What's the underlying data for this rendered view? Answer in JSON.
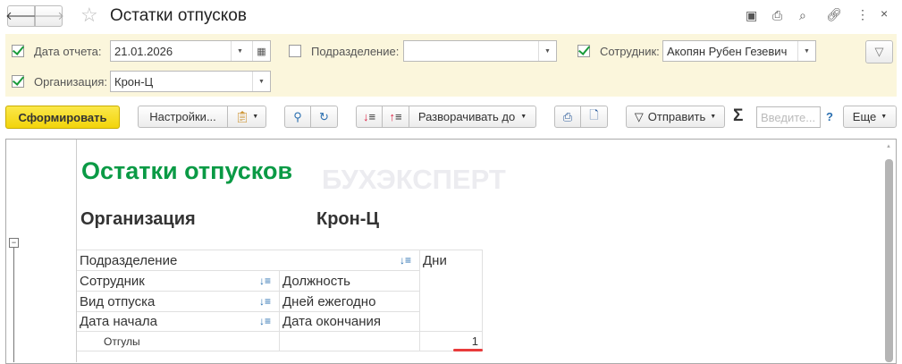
{
  "window": {
    "title": "Остатки отпусков",
    "close": "×"
  },
  "filters": {
    "report_date": {
      "label": "Дата отчета:",
      "value": "21.01.2026",
      "checked": true
    },
    "department": {
      "label": "Подразделение:",
      "value": "",
      "checked": false
    },
    "employee": {
      "label": "Сотрудник:",
      "value": "Акопян Рубен Гезевич",
      "checked": true
    },
    "organization": {
      "label": "Организация:",
      "value": "Крон-Ц",
      "checked": true
    }
  },
  "toolbar": {
    "generate": "Сформировать",
    "settings": "Настройки...",
    "expand_to": "Разворачивать до",
    "send": "Отправить",
    "sigma": "Σ",
    "search_placeholder": "Введите...",
    "help": "?",
    "more": "Еще"
  },
  "report": {
    "title": "Остатки отпусков",
    "watermark": "БУХЭКСПЕРТ",
    "org_label": "Организация",
    "org_value": "Крон-Ц",
    "headers": {
      "department": "Подразделение",
      "days": "Дни",
      "employee": "Сотрудник",
      "position": "Должность",
      "leave_type": "Вид отпуска",
      "days_yearly": "Дней ежегодно",
      "start_date": "Дата начала",
      "end_date": "Дата окончания"
    },
    "row": {
      "label": "Отгулы",
      "value": "1"
    }
  },
  "colors": {
    "accent": "#f5d615",
    "title_green": "#0a9a45",
    "filter_bg": "#fbf6dc"
  }
}
